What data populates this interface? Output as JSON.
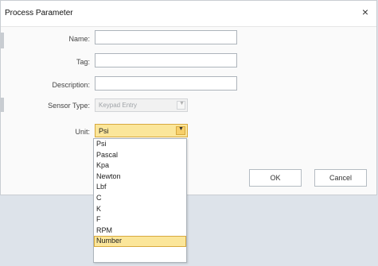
{
  "dialog": {
    "title": "Process Parameter",
    "close_glyph": "×"
  },
  "form": {
    "name_label": "Name:",
    "name_value": "",
    "tag_label": "Tag:",
    "tag_value": "",
    "description_label": "Description:",
    "description_value": "",
    "sensor_type_label": "Sensor Type:",
    "sensor_type_value": "Keypad Entry",
    "unit_label": "Unit:",
    "unit_value": "Psi"
  },
  "unit_options": [
    "Psi",
    "Pascal",
    "Kpa",
    "Newton",
    "Lbf",
    "C",
    "K",
    "F",
    "RPM",
    "Number"
  ],
  "selected_option": "Number",
  "buttons": {
    "ok": "OK",
    "cancel": "Cancel"
  },
  "colors": {
    "highlight": "#fbe69a",
    "highlight_border": "#d7a93e"
  },
  "icons": {
    "close": "close-icon",
    "dropdown": "chevron-down-icon"
  }
}
